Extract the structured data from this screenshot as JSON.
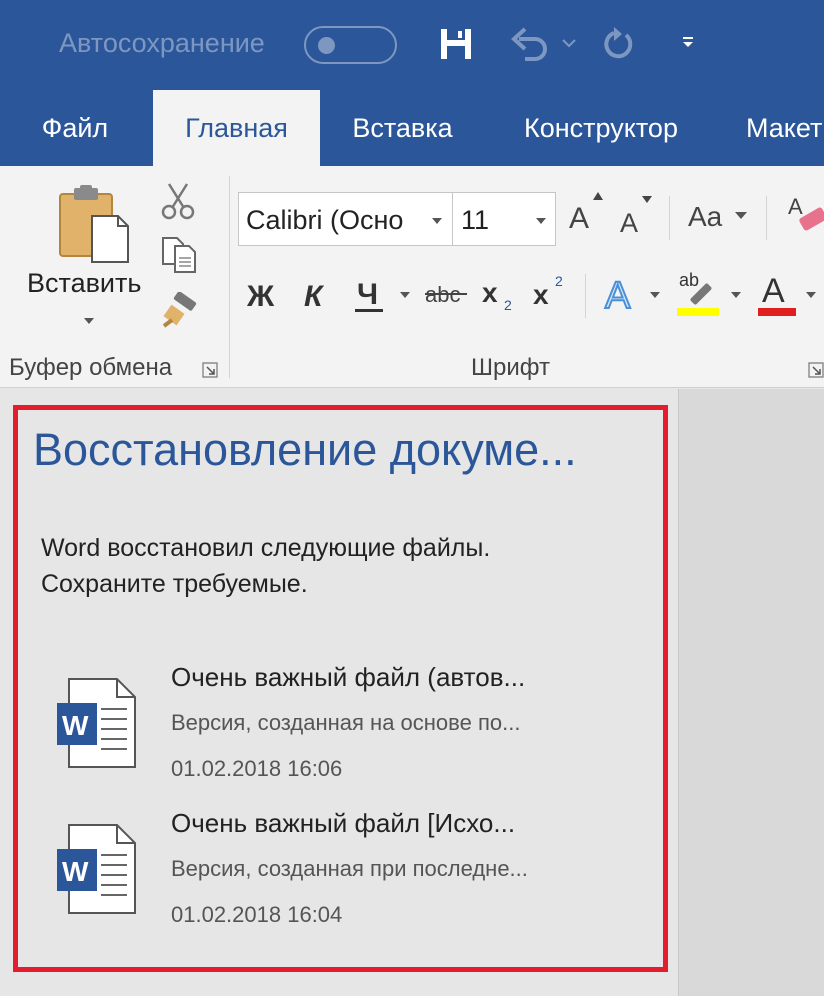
{
  "title_bar": {
    "autosave_label": "Автосохранение"
  },
  "ribbon_tabs": [
    {
      "label": "Файл"
    },
    {
      "label": "Главная",
      "active": true
    },
    {
      "label": "Вставка"
    },
    {
      "label": "Конструктор"
    },
    {
      "label": "Макет"
    }
  ],
  "clipboard_group": {
    "paste_label": "Вставить",
    "group_label": "Буфер обмена"
  },
  "font_group": {
    "font_name": "Calibri (Осно",
    "font_size": "11",
    "grow_glyph": "A",
    "shrink_glyph": "A",
    "case_glyph": "Aa",
    "bold_glyph": "Ж",
    "italic_glyph": "К",
    "underline_glyph": "Ч",
    "strike_glyph": "abc",
    "sub_glyph": "x",
    "sub_index": "2",
    "sup_glyph": "x",
    "sup_index": "2",
    "effects_glyph": "A",
    "highlight_glyph": "ab",
    "fontcolor_glyph": "A",
    "group_label": "Шрифт"
  },
  "colors": {
    "brand": "#2b579a",
    "highlight_frame": "#e31d2e",
    "highlight_yellow": "#ffff00",
    "font_color_red": "#e0201f",
    "word_blue": "#2b579a"
  },
  "recovery_pane": {
    "title": "Восстановление докуме...",
    "message_line1": "Word восстановил следующие файлы.",
    "message_line2": "Сохраните требуемые.",
    "files": [
      {
        "name": "Очень важный файл  (автов...",
        "description": "Версия, созданная на основе по...",
        "timestamp": "01.02.2018 16:06",
        "icon": "word-doc-icon"
      },
      {
        "name": "Очень важный файл  [Исхо...",
        "description": "Версия, созданная при последне...",
        "timestamp": "01.02.2018 16:04",
        "icon": "word-doc-icon"
      }
    ]
  }
}
